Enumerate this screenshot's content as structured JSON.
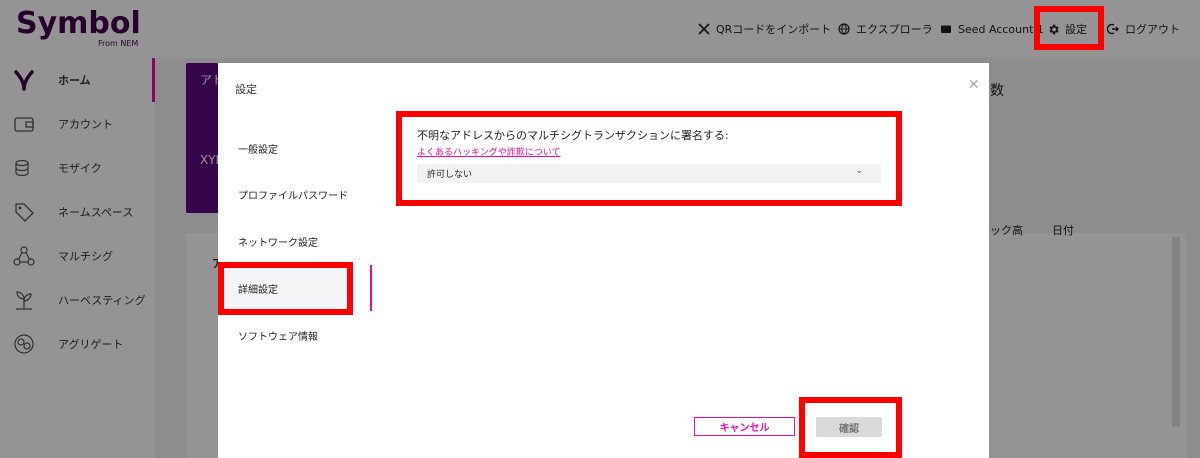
{
  "app": {
    "logo_text": "Symbol",
    "logo_sub": "From NEM"
  },
  "topnav": {
    "import_qr": "QRコードをインポート",
    "explorer": "エクスプローラ",
    "account": "Seed Account 1",
    "settings": "設定",
    "logout": "ログアウト"
  },
  "sidebar": {
    "items": [
      {
        "label": "ホーム",
        "icon": "symbol-icon"
      },
      {
        "label": "アカウント",
        "icon": "wallet-icon"
      },
      {
        "label": "モザイク",
        "icon": "coins-icon"
      },
      {
        "label": "ネームスペース",
        "icon": "tag-icon"
      },
      {
        "label": "マルチシグ",
        "icon": "network-icon"
      },
      {
        "label": "ハーベスティング",
        "icon": "plant-icon"
      },
      {
        "label": "アグリゲート",
        "icon": "aggregate-icon"
      }
    ]
  },
  "background": {
    "card_label_1": "アド",
    "card_label_2": "XYM",
    "panel_title": "ア",
    "count_label": "数",
    "col_block_height": "ック高",
    "col_date": "日付"
  },
  "modal": {
    "title": "設定",
    "tabs": [
      "一般設定",
      "プロファイルパスワード",
      "ネットワーク設定",
      "詳細設定",
      "ソフトウェア情報"
    ],
    "active_tab": "詳細設定",
    "setting_label": "不明なアドレスからのマルチシグトランザクションに署名する:",
    "setting_link": "よくあるハッキングや詐欺について",
    "select_value": "許可しない",
    "cancel": "キャンセル",
    "confirm": "確認"
  },
  "colors": {
    "brand": "#44004e",
    "accent": "#ee0aa8",
    "highlight": "#ff0000"
  }
}
